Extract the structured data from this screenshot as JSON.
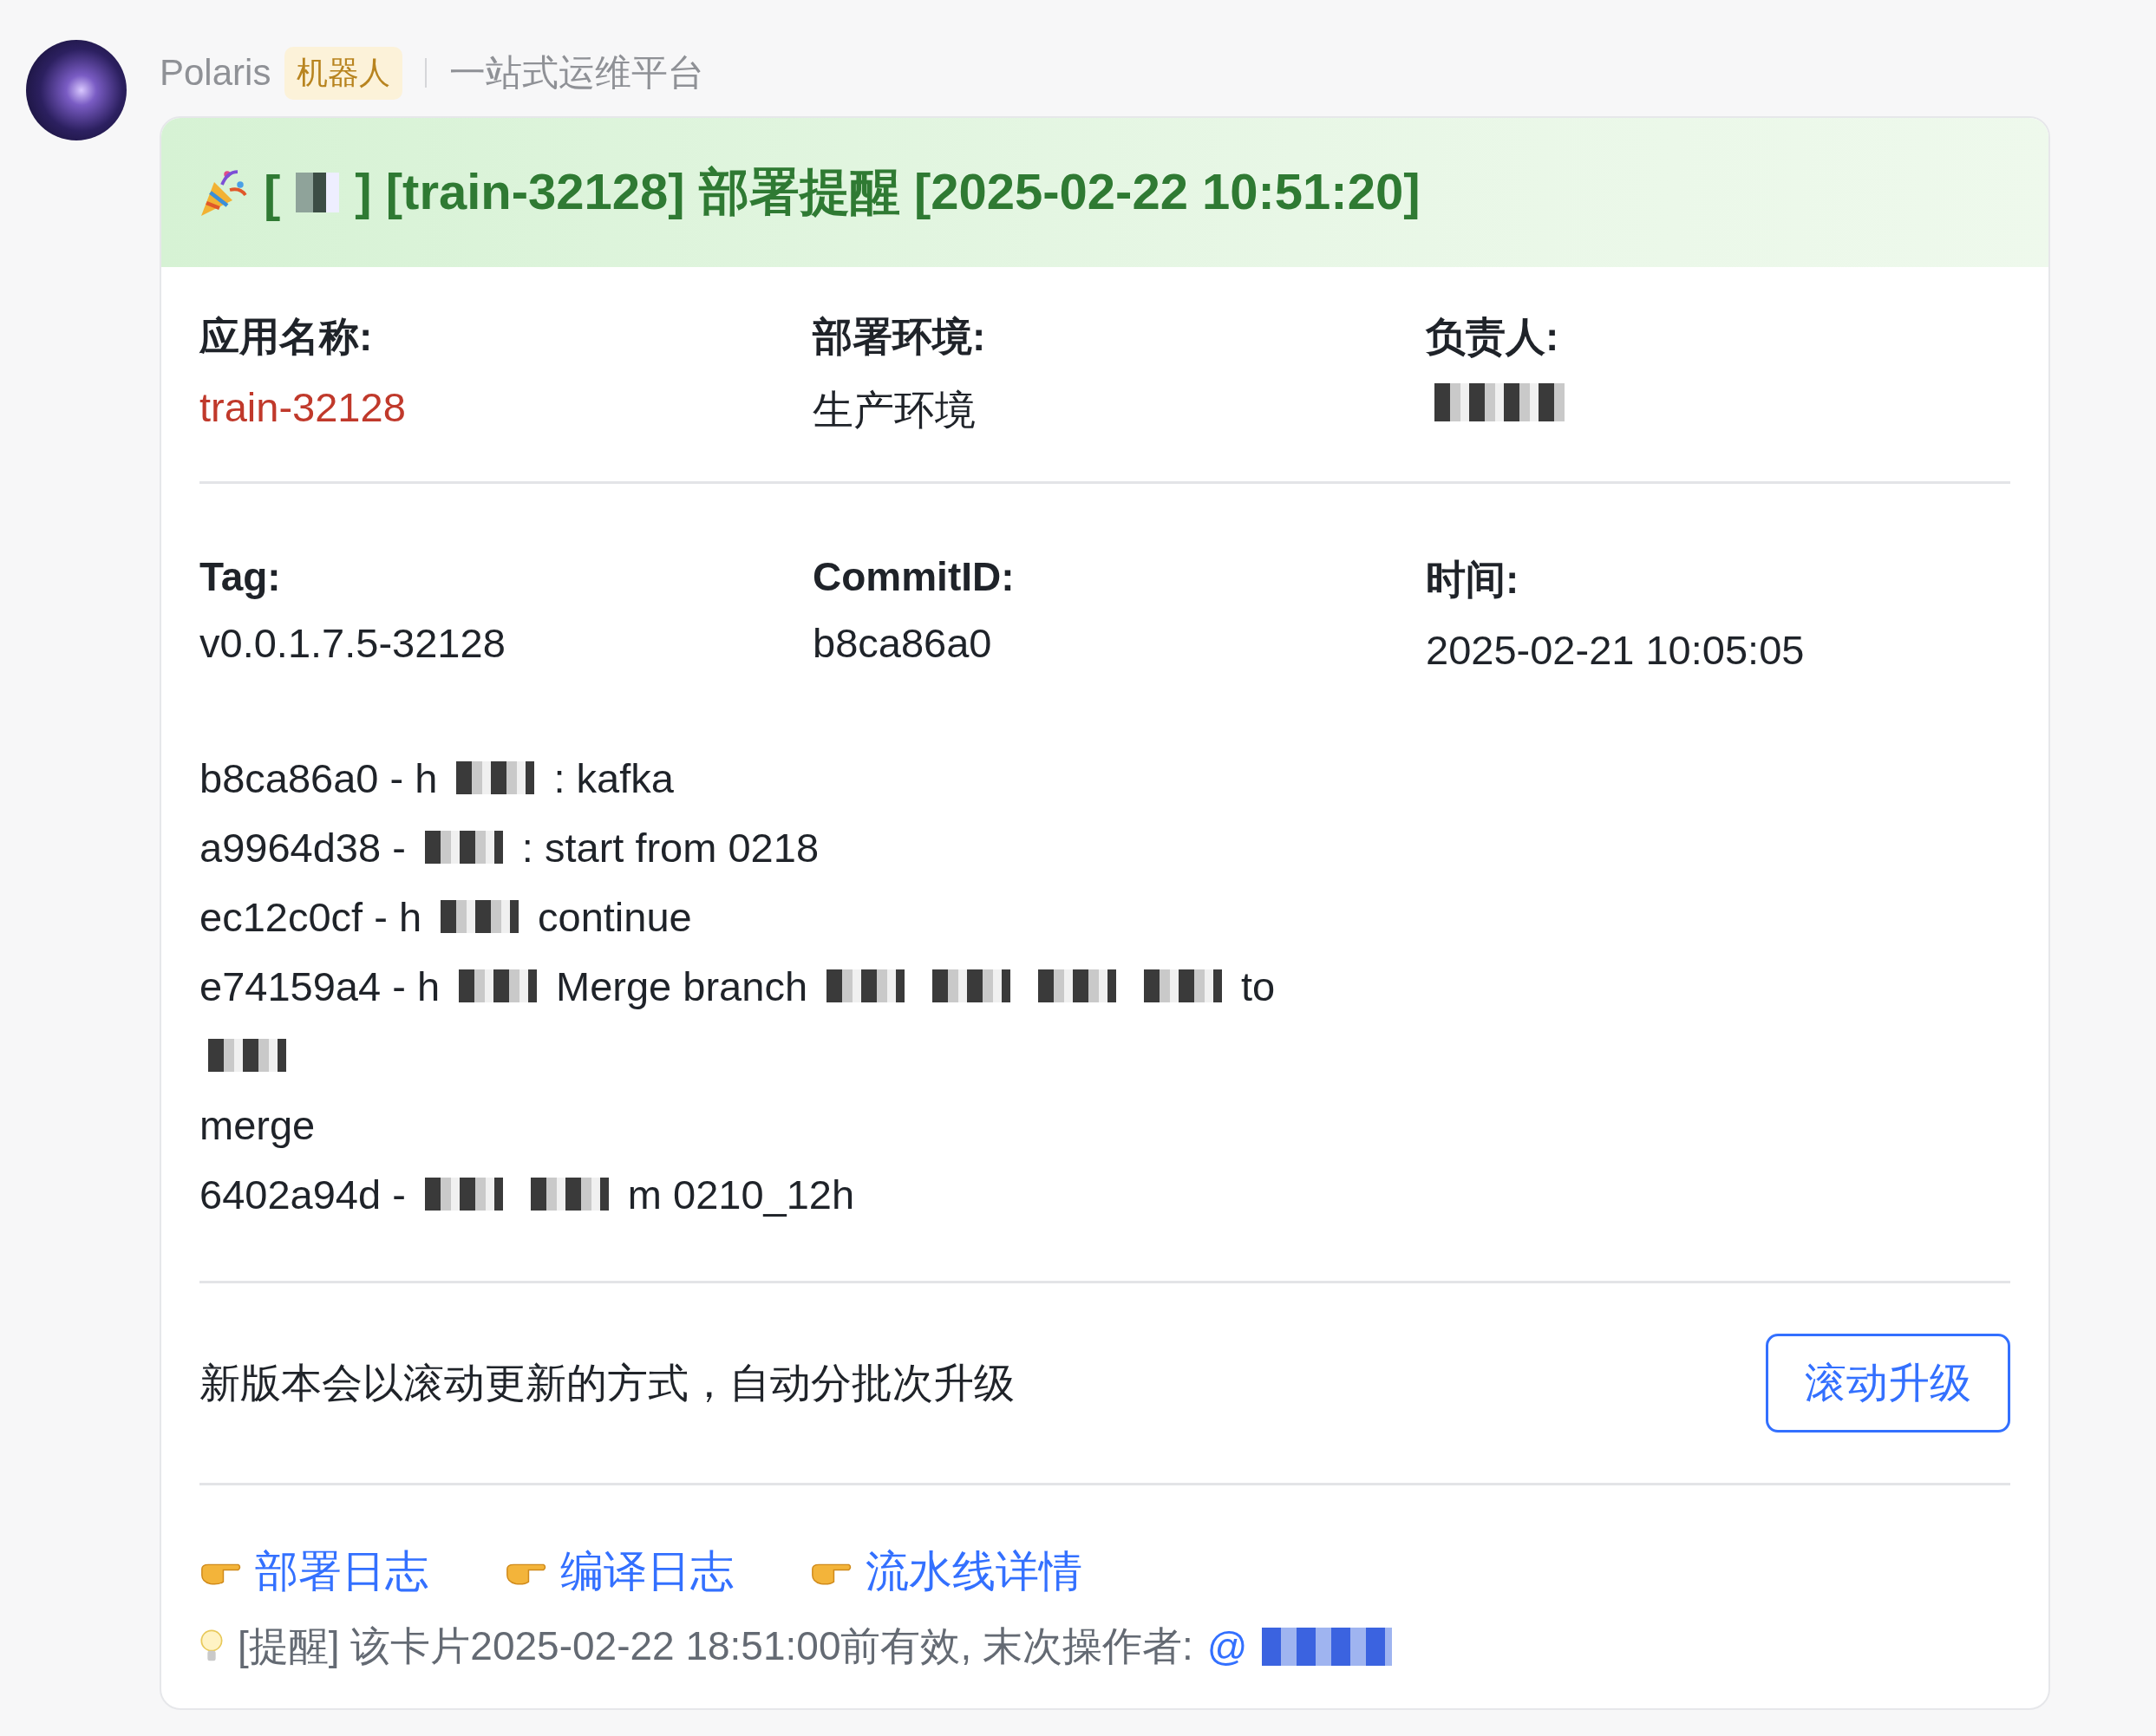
{
  "sender": {
    "name": "Polaris",
    "badge": "机器人",
    "subtitle": "一站式运维平台"
  },
  "card": {
    "title_segments": [
      {
        "kind": "text",
        "text": "["
      },
      {
        "kind": "redacted"
      },
      {
        "kind": "text",
        "text": "] [train-32128] 部署提醒 [2025-02-22 10:51:20]"
      }
    ],
    "fields": [
      {
        "label": "应用名称:",
        "value": "train-32128",
        "kind": "highlight"
      },
      {
        "label": "部署环境:",
        "value": "生产环境",
        "kind": "plain"
      },
      {
        "label": "负责人:",
        "kind": "redacted"
      },
      {
        "label": "Tag:",
        "value": "v0.0.1.7.5-32128",
        "kind": "plain"
      },
      {
        "label": "CommitID:",
        "value": "b8ca86a0",
        "kind": "plain"
      },
      {
        "label": "时间:",
        "value": "2025-02-21 10:05:05",
        "kind": "plain"
      }
    ],
    "commits": [
      [
        {
          "kind": "text",
          "text": "b8ca86a0 - h"
        },
        {
          "kind": "redacted"
        },
        {
          "kind": "text",
          "text": ": kafka"
        }
      ],
      [
        {
          "kind": "text",
          "text": "a9964d38 -"
        },
        {
          "kind": "redacted"
        },
        {
          "kind": "text",
          "text": ": start from 0218"
        }
      ],
      [
        {
          "kind": "text",
          "text": "ec12c0cf - h"
        },
        {
          "kind": "redacted"
        },
        {
          "kind": "text",
          "text": "continue"
        }
      ],
      [
        {
          "kind": "text",
          "text": "e74159a4 - h"
        },
        {
          "kind": "redacted"
        },
        {
          "kind": "text",
          "text": "Merge branch"
        },
        {
          "kind": "redacted"
        },
        {
          "kind": "redacted"
        },
        {
          "kind": "redacted"
        },
        {
          "kind": "redacted"
        },
        {
          "kind": "text",
          "text": "to"
        }
      ],
      [
        {
          "kind": "redacted"
        }
      ],
      [
        {
          "kind": "text",
          "text": "merge"
        }
      ],
      [
        {
          "kind": "text",
          "text": "6402a94d -"
        },
        {
          "kind": "redacted"
        },
        {
          "kind": "redacted"
        },
        {
          "kind": "text",
          "text": "m 0210_12h"
        }
      ]
    ],
    "notice": "新版本会以滚动更新的方式，自动分批次升级",
    "action_button": "滚动升级",
    "links": [
      "部署日志",
      "编译日志",
      "流水线详情"
    ],
    "reminder": "[提醒] 该卡片2025-02-22 18:51:00前有效, 末次操作者:",
    "mention": "@"
  }
}
